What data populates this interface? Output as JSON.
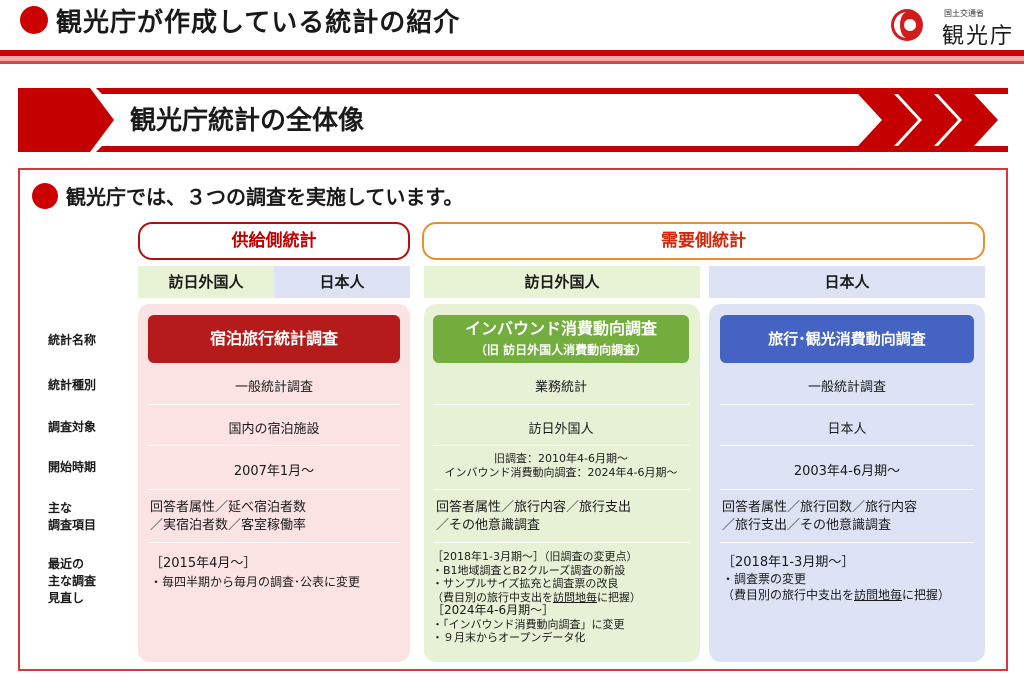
{
  "header": {
    "title": "観光庁が作成している統計の紹介",
    "logo_small": "国土交通省",
    "logo_big": "観光庁"
  },
  "banner": {
    "title": "観光庁統計の全体像"
  },
  "section": {
    "title": "観光庁では、３つの調査を実施しています。"
  },
  "categories": {
    "supply": "供給側統計",
    "demand": "需要側統計"
  },
  "subheaders": [
    "訪日外国人",
    "日本人",
    "訪日外国人",
    "日本人"
  ],
  "row_labels": {
    "name": "統計名称",
    "type": "統計種別",
    "target": "調査対象",
    "start": "開始時期",
    "items_l1": "主な",
    "items_l2": "調査項目",
    "review_l1": "最近の",
    "review_l2": "主な調査",
    "review_l3": "見直し"
  },
  "surveys": [
    {
      "name": "宿泊旅行統計調査",
      "type": "一般統計調査",
      "target": "国内の宿泊施設",
      "start": "2007年1月～",
      "items_l1": "回答者属性／延べ宿泊者数",
      "items_l2": "／実宿泊者数／客室稼働率",
      "review": [
        "［2015年4月～］",
        "・毎四半期から毎月の調査･公表に変更"
      ]
    },
    {
      "name_l1": "インバウンド消費動向調査",
      "name_l2": "（旧 訪日外国人消費動向調査）",
      "type": "業務統計",
      "target": "訪日外国人",
      "start_l1": "旧調査：2010年4-6月期～",
      "start_l2": "インバウンド消費動向調査：2024年4-6月期～",
      "items_l1": "回答者属性／旅行内容／旅行支出",
      "items_l2": "／その他意識調査",
      "review": [
        "［2018年1-3月期～］（旧調査の変更点）",
        "・B1地域調査とB2クルーズ調査の新設",
        "・サンプルサイズ拡充と調査票の改良",
        "（費目別の旅行中支出を",
        "訪問地毎",
        "に把握）",
        "［2024年4-6月期～］",
        "・「インバウンド消費動向調査」に変更",
        "・９月末からオープンデータ化"
      ]
    },
    {
      "name": "旅行･観光消費動向調査",
      "type": "一般統計調査",
      "target": "日本人",
      "start": "2003年4-6月期～",
      "items_l1": "回答者属性／旅行回数／旅行内容",
      "items_l2": "／旅行支出／その他意識調査",
      "review": [
        "［2018年1-3月期～］",
        "・調査票の変更",
        "（費目別の旅行中支出を",
        "訪問地毎",
        "に把握）"
      ]
    }
  ],
  "colors": {
    "accent_red": "#cc0000",
    "supply_pink": "#fbe3e3",
    "demand_green": "#e6f1d6",
    "domestic_blue": "#dde3f4",
    "accommodation_box": "#b51b1b",
    "inbound_box": "#72ad3e",
    "domestic_box": "#4463c2"
  }
}
